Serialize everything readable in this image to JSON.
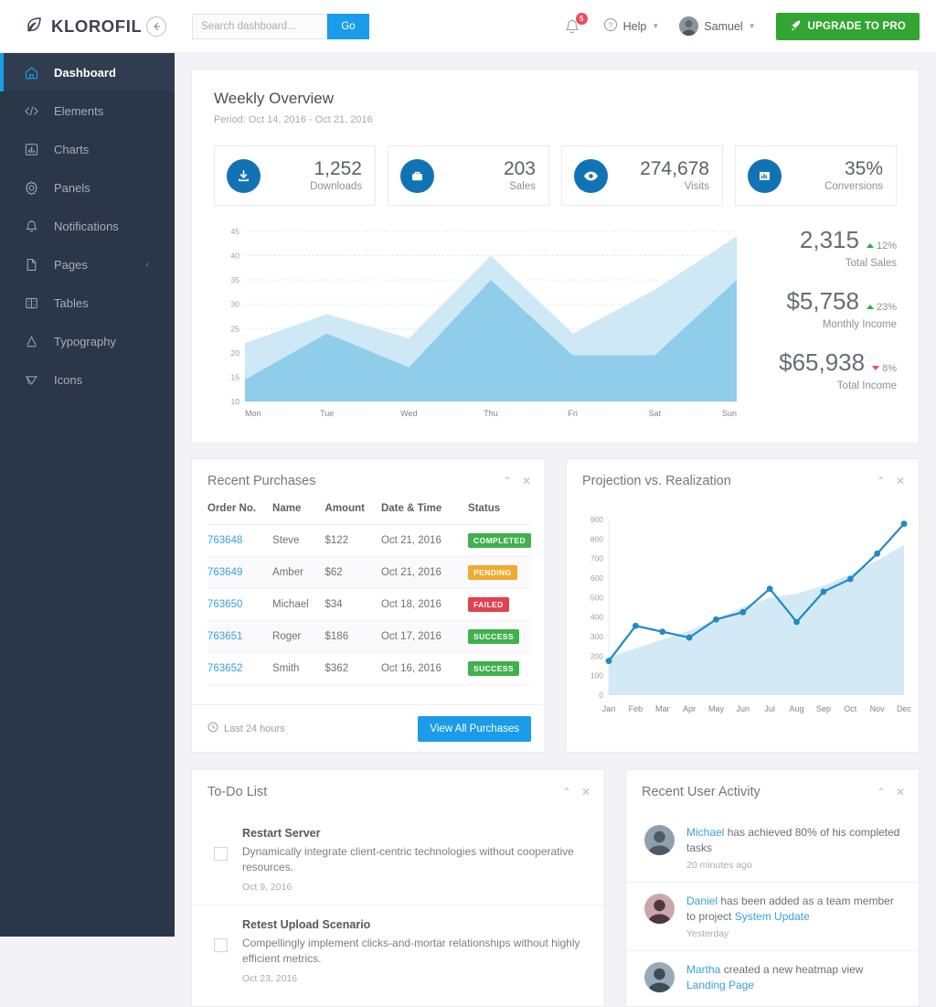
{
  "header": {
    "brand": "KLOROFIL",
    "collapse_icon": "arrow-left-circle-icon",
    "search": {
      "placeholder": "Search dashboard...",
      "value": "",
      "go_label": "Go"
    },
    "notifications": {
      "icon": "bell-icon",
      "count": "5"
    },
    "help": {
      "label": "Help",
      "icon": "question-circle-icon"
    },
    "user": {
      "name": "Samuel",
      "avatar": "user-avatar"
    },
    "upgrade": {
      "label": "UPGRADE TO PRO",
      "icon": "rocket-icon",
      "color": "#33a532"
    }
  },
  "sidebar": {
    "items": [
      {
        "label": "Dashboard",
        "icon": "home-icon",
        "active": true
      },
      {
        "label": "Elements",
        "icon": "code-icon",
        "active": false
      },
      {
        "label": "Charts",
        "icon": "bar-chart-icon",
        "active": false
      },
      {
        "label": "Panels",
        "icon": "gear-icon",
        "active": false
      },
      {
        "label": "Notifications",
        "icon": "bell-icon",
        "active": false
      },
      {
        "label": "Pages",
        "icon": "file-icon",
        "active": false,
        "arrow": "chevron-left-icon"
      },
      {
        "label": "Tables",
        "icon": "table-icon",
        "active": false
      },
      {
        "label": "Typography",
        "icon": "letter-a-icon",
        "active": false
      },
      {
        "label": "Icons",
        "icon": "diamond-icon",
        "active": false
      }
    ]
  },
  "weekly": {
    "title": "Weekly Overview",
    "period": "Period: Oct 14, 2016 - Oct 21, 2016",
    "stats": [
      {
        "value": "1,252",
        "label": "Downloads",
        "icon": "download-icon"
      },
      {
        "value": "203",
        "label": "Sales",
        "icon": "briefcase-icon"
      },
      {
        "value": "274,678",
        "label": "Visits",
        "icon": "eye-icon"
      },
      {
        "value": "35%",
        "label": "Conversions",
        "icon": "bar-chart-icon"
      }
    ],
    "totals": [
      {
        "value": "2,315",
        "delta": "12%",
        "direction": "up",
        "label": "Total Sales"
      },
      {
        "value": "$5,758",
        "delta": "23%",
        "direction": "up",
        "label": "Monthly Income"
      },
      {
        "value": "$65,938",
        "delta": "8%",
        "direction": "down",
        "label": "Total Income"
      }
    ]
  },
  "purchases": {
    "title": "Recent Purchases",
    "collapse_icon": "chevron-up-icon",
    "close_icon": "close-icon",
    "columns": [
      "Order No.",
      "Name",
      "Amount",
      "Date & Time",
      "Status"
    ],
    "rows": [
      {
        "order": "763648",
        "name": "Steve",
        "amount": "$122",
        "date": "Oct 21, 2016",
        "status": "COMPLETED",
        "status_kind": "completed"
      },
      {
        "order": "763649",
        "name": "Amber",
        "amount": "$62",
        "date": "Oct 21, 2016",
        "status": "PENDING",
        "status_kind": "pending"
      },
      {
        "order": "763650",
        "name": "Michael",
        "amount": "$34",
        "date": "Oct 18, 2016",
        "status": "FAILED",
        "status_kind": "failed"
      },
      {
        "order": "763651",
        "name": "Roger",
        "amount": "$186",
        "date": "Oct 17, 2016",
        "status": "SUCCESS",
        "status_kind": "success"
      },
      {
        "order": "763652",
        "name": "Smith",
        "amount": "$362",
        "date": "Oct 16, 2016",
        "status": "SUCCESS",
        "status_kind": "success"
      }
    ],
    "footer_note": "Last 24 hours",
    "footer_icon": "clock-icon",
    "view_all_label": "View All Purchases"
  },
  "projection": {
    "title": "Projection vs. Realization",
    "collapse_icon": "chevron-up-icon",
    "close_icon": "close-icon"
  },
  "todo": {
    "title": "To-Do List",
    "collapse_icon": "chevron-up-icon",
    "close_icon": "close-icon",
    "items": [
      {
        "title": "Restart Server",
        "desc": "Dynamically integrate client-centric technologies without cooperative resources.",
        "date": "Oct 9, 2016",
        "checked": false
      },
      {
        "title": "Retest Upload Scenario",
        "desc": "Compellingly implement clicks-and-mortar relationships without highly efficient metrics.",
        "date": "Oct 23, 2016",
        "checked": false
      }
    ]
  },
  "activity": {
    "title": "Recent User Activity",
    "collapse_icon": "chevron-up-icon",
    "close_icon": "close-icon",
    "items": [
      {
        "user": "Michael",
        "text": " has achieved 80% of his completed tasks",
        "link": "",
        "time": "20 minutes ago"
      },
      {
        "user": "Daniel",
        "text": " has been added as a team member to project ",
        "link": "System Update",
        "time": "Yesterday"
      },
      {
        "user": "Martha",
        "text": " created a new heatmap view ",
        "link": "Landing Page",
        "time": ""
      }
    ]
  },
  "chart_data": [
    {
      "type": "area",
      "title": "Weekly Overview",
      "categories": [
        "Mon",
        "Tue",
        "Wed",
        "Thu",
        "Fri",
        "Sat",
        "Sun"
      ],
      "series": [
        {
          "name": "series-light",
          "values": [
            22,
            28,
            23,
            40,
            24,
            33,
            44
          ],
          "color": "#cfe8f5"
        },
        {
          "name": "series-dark",
          "values": [
            14.5,
            24,
            17,
            35,
            19.5,
            19.5,
            35
          ],
          "color": "#8fcdea"
        }
      ],
      "ylim": [
        10,
        45
      ],
      "yticks": [
        10,
        15,
        20,
        25,
        30,
        35,
        40,
        45
      ],
      "xlabel": "",
      "ylabel": "",
      "grid": true,
      "legend": "none"
    },
    {
      "type": "line",
      "title": "Projection vs. Realization",
      "categories": [
        "Jan",
        "Feb",
        "Mar",
        "Apr",
        "May",
        "Jun",
        "Jul",
        "Aug",
        "Sep",
        "Oct",
        "Nov",
        "Dec"
      ],
      "series": [
        {
          "name": "Realization",
          "values": [
            175,
            355,
            325,
            295,
            388,
            425,
            545,
            375,
            530,
            595,
            725,
            878
          ],
          "color": "#2289c4",
          "markers": true
        },
        {
          "name": "Projection",
          "values": [
            195,
            240,
            285,
            330,
            390,
            450,
            500,
            520,
            560,
            620,
            690,
            770
          ],
          "color": "#d3eaf6",
          "fill": true
        }
      ],
      "ylim": [
        0,
        900
      ],
      "yticks": [
        0,
        100,
        200,
        300,
        400,
        500,
        600,
        700,
        800,
        900
      ],
      "xlabel": "",
      "ylabel": "",
      "grid": false,
      "legend": "none"
    }
  ]
}
